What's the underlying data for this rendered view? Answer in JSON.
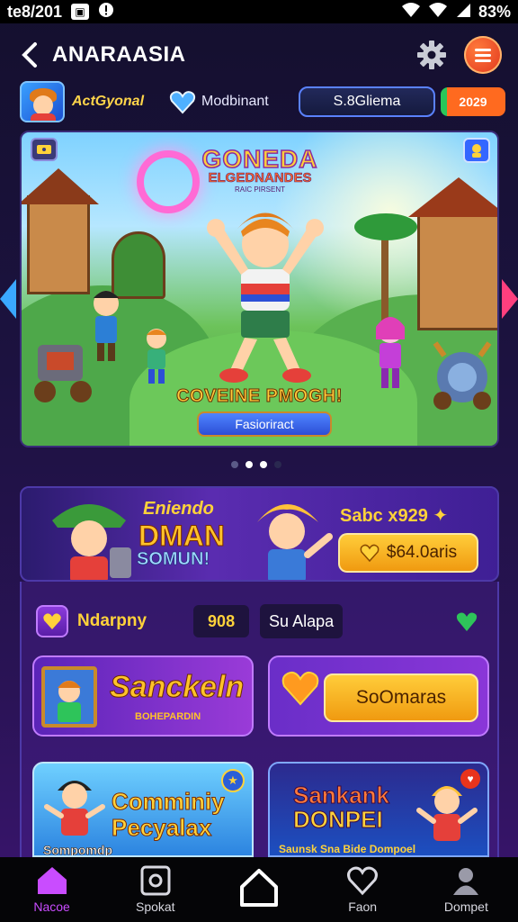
{
  "status_bar": {
    "time": "te8/201",
    "battery": "83%"
  },
  "header": {
    "title": "ANARAASIA"
  },
  "user": {
    "name": "ActGyonal",
    "status": "Modbinant",
    "coins": "S.8Gliema",
    "score": "2029"
  },
  "hero": {
    "logo_line1": "GONEDA",
    "logo_line2": "ELGEDNANDES",
    "logo_line3": "RAIC PIRSENT",
    "caption": "COVEINE PMOGH!",
    "cta": "Fasioriract"
  },
  "carousel": {
    "count": 3,
    "active_index": 1
  },
  "promo": {
    "title_line1": "Eniendo",
    "title_line2": "DMAN",
    "title_line3": "SOMUN!",
    "reward": "Sabc x929",
    "button": "$64.0aris"
  },
  "stats": {
    "label": "Ndarpny",
    "value": "908",
    "text": "Su Alapa"
  },
  "cards": {
    "sancklein_title": "Sanckeln",
    "sancklein_sub": "BOHEPARDIN",
    "reward_button": "SoOmaras"
  },
  "games": [
    {
      "title_line1": "Comminiy",
      "title_line2": "Pecyalax",
      "sub": "Sompomdp"
    },
    {
      "title_line1": "Sankank",
      "title_line2": "DONPEI",
      "sub": "Saunsk Sna Bide Dompoel"
    }
  ],
  "nav": [
    {
      "label": "Nacoe"
    },
    {
      "label": "Spokat"
    },
    {
      "label": ""
    },
    {
      "label": "Faon"
    },
    {
      "label": "Dompet"
    }
  ],
  "colors": {
    "accent_yellow": "#ffd23a",
    "accent_purple": "#c94cff",
    "accent_orange": "#f09a10",
    "background": "#1c1240"
  }
}
